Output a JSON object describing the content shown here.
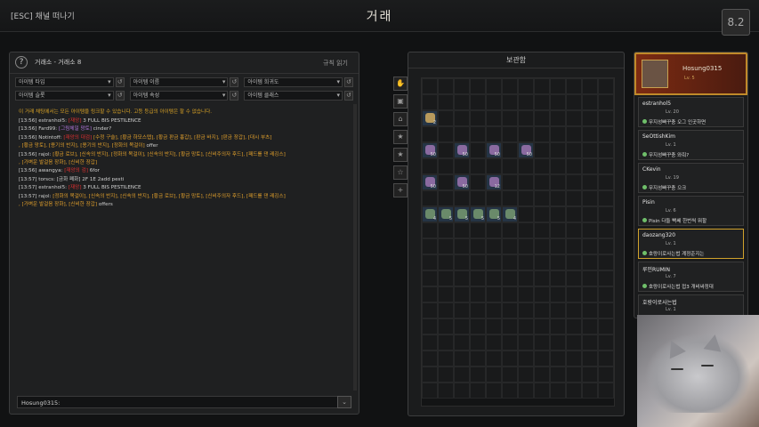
{
  "top": {
    "esc_label": "[ESC] 채널 떠나기",
    "title": "거래",
    "corner_label": "8.2"
  },
  "chat_panel": {
    "help": "?",
    "title": "거래소 - 거래소 8",
    "rules": "규칙 읽기",
    "filters": [
      "아이템 타입",
      "아이템 이름",
      "아이템 희귀도",
      "아이템 슬롯",
      "아이템 속성",
      "아이템 클래스"
    ],
    "notice": "이 거래 채팅에서는 모든 아이템을 링크할 수 있습니다. 고등 등급의 아이템은 할 수 없습니다.",
    "messages": [
      {
        "time": "[13:56]",
        "name": "estranhol5:",
        "red": "[재앙]",
        "text": "3 FULL BIS PESTILENCE"
      },
      {
        "time": "[13:56]",
        "name": "Fard99:",
        "itemp": "[그림체일 망토]",
        "text": "cinder?"
      },
      {
        "time": "[13:56]",
        "name": "Notintoff:",
        "red": "[재앙의 대검]",
        "item": "[수정 구슬], [황금 하모스텝], [황금 판금 흉갑], [판금 바지], [판금 장갑], [대시 부츠]",
        "text": ""
      },
      {
        "time": "",
        "name": "",
        "item": ", [황금 망토], [용기의 반지], [용기의 반지], [정화의 목걸이]",
        "text": "offer"
      },
      {
        "time": "[13:56]",
        "name": "rajol:",
        "item": "[황금 로브], [신속의 반지], [정화의 목걸이], [신속의 반지], [황금 망토], [신비주의자 후드], [패드를 댄 레깅스]",
        "text": ""
      },
      {
        "time": "",
        "name": "",
        "item": ", [가벼운 발걸음 장화], [신비한 장갑]",
        "text": ""
      },
      {
        "time": "[13:56]",
        "name": "awangya:",
        "red": "[재앙의 검]",
        "text": "6for"
      },
      {
        "time": "[13:57]",
        "name": "torscs:",
        "tag": "[금화 폐화]",
        "text": "2F 1E 2add pesti"
      },
      {
        "time": "[13:57]",
        "name": "estranhol5:",
        "red": "[재앙]",
        "text": "3 FULL BIS PESTILENCE"
      },
      {
        "time": "[13:57]",
        "name": "rajol:",
        "item": "[정화의 목걸이], [신속의 반지], [신속의 반지], [황금 로브], [황금 망토], [신비주의자 후드], [패드를 댄 레깅스]",
        "text": ""
      },
      {
        "time": "",
        "name": "",
        "item": ", [가벼운 발걸음 장화], [신비한 장갑]",
        "text": "offers"
      }
    ],
    "input_value": "Hosung0315:"
  },
  "storage": {
    "title": "보관함",
    "items": [
      {
        "row": 2,
        "col": 0,
        "count": "2",
        "color": "#b89a5c"
      },
      {
        "row": 4,
        "col": 0,
        "count": "50",
        "color": "#8a6aa0"
      },
      {
        "row": 4,
        "col": 2,
        "count": "50",
        "color": "#8a6aa0"
      },
      {
        "row": 4,
        "col": 4,
        "count": "50",
        "color": "#8a6aa0"
      },
      {
        "row": 4,
        "col": 6,
        "count": "50",
        "color": "#8a6aa0"
      },
      {
        "row": 6,
        "col": 0,
        "count": "50",
        "color": "#8a6aa0"
      },
      {
        "row": 6,
        "col": 2,
        "count": "50",
        "color": "#8a6aa0"
      },
      {
        "row": 6,
        "col": 4,
        "count": "12",
        "color": "#8a6aa0"
      },
      {
        "row": 8,
        "col": 0,
        "count": "4",
        "color": "#6a8a6a"
      },
      {
        "row": 8,
        "col": 1,
        "count": "5",
        "color": "#6a8a6a"
      },
      {
        "row": 8,
        "col": 2,
        "count": "5",
        "color": "#6a8a6a"
      },
      {
        "row": 8,
        "col": 3,
        "count": "5",
        "color": "#6a8a6a"
      },
      {
        "row": 8,
        "col": 4,
        "count": "5",
        "color": "#6a8a6a"
      },
      {
        "row": 8,
        "col": 5,
        "count": "4",
        "color": "#6a8a6a"
      }
    ]
  },
  "right_panel": {
    "profile_name": "Hosung0315",
    "profile_level": "Lv. 5",
    "entries": [
      {
        "name": "estranhol5",
        "level": "Lv. 20",
        "msg": "무지성빠꾸충 오그 인곳하면"
      },
      {
        "name": "SeOttishKim",
        "level": "Lv. 1",
        "msg": "무지성빠꾸충 와줘?"
      },
      {
        "name": "CKevin",
        "level": "Lv. 19",
        "msg": "무지성빠꾸충 으크"
      },
      {
        "name": "Pisin",
        "level": "Lv. 6",
        "msg": "Pisin 다들 빡쎄 한번씩 뭐할"
      },
      {
        "name": "daozang320",
        "level": "Lv. 1",
        "msg": "호랑이로사는법 계정준지는"
      },
      {
        "name": "루민RUMIN",
        "level": "Lv. 7",
        "msg": "호랑이로사는법 접3 개비싸정대"
      },
      {
        "name": "호랑이로사는법",
        "level": "Lv. 1",
        "msg": "호랑이로사는법 오"
      }
    ]
  },
  "side_tabs": [
    "hand-icon",
    "bag-icon",
    "chest-icon",
    "star-icon",
    "star-icon",
    "star-outline-icon",
    "plus-icon"
  ]
}
